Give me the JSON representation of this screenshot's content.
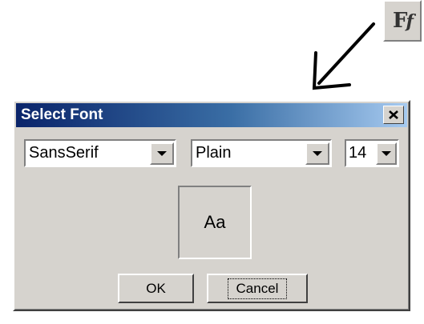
{
  "toolbar": {
    "font_button_icon": "font-select-icon",
    "font_button_glyph_main": "F",
    "font_button_glyph_sub": "f"
  },
  "dialog": {
    "title": "Select Font",
    "close_icon": "close-icon",
    "family": {
      "selected": "SansSerif"
    },
    "style": {
      "selected": "Plain"
    },
    "size": {
      "selected": "14"
    },
    "preview_text": "Aa",
    "ok_label": "OK",
    "cancel_label": "Cancel"
  },
  "colors": {
    "title_bar_start": "#0a246a",
    "title_bar_end": "#a6caf0",
    "dialog_face": "#d6d3ce",
    "annotation_arrow": "#000000"
  }
}
